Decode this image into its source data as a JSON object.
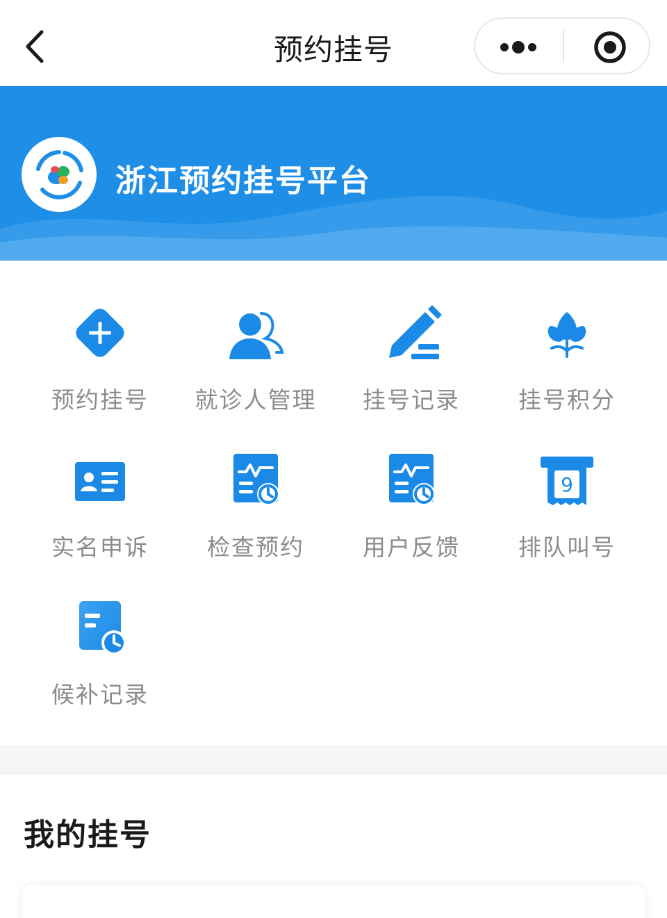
{
  "navbar": {
    "title": "预约挂号",
    "back_icon": "chevron-left-icon",
    "more_icon": "more-dots-icon",
    "close_icon": "target-circle-icon"
  },
  "banner": {
    "title": "浙江预约挂号平台",
    "background_color": "#1e8ee6",
    "logo_icon": "platform-logo-icon"
  },
  "services": [
    {
      "label": "预约挂号",
      "icon": "plus-diamond-icon"
    },
    {
      "label": "就诊人管理",
      "icon": "users-icon"
    },
    {
      "label": "挂号记录",
      "icon": "pencil-icon"
    },
    {
      "label": "挂号积分",
      "icon": "lotus-icon"
    },
    {
      "label": "实名申诉",
      "icon": "id-card-icon"
    },
    {
      "label": "检查预约",
      "icon": "report-clock-icon"
    },
    {
      "label": "用户反馈",
      "icon": "feedback-clock-icon"
    },
    {
      "label": "排队叫号",
      "icon": "queue-ticket-icon",
      "ticket_number": "9"
    },
    {
      "label": "候补记录",
      "icon": "waitlist-clock-icon"
    }
  ],
  "my_section": {
    "title": "我的挂号"
  },
  "colors": {
    "accent": "#1e8ee6",
    "icon_blue": "#1b8ae6",
    "label_gray": "#8c8c8c",
    "separator": "#f5f5f5"
  }
}
